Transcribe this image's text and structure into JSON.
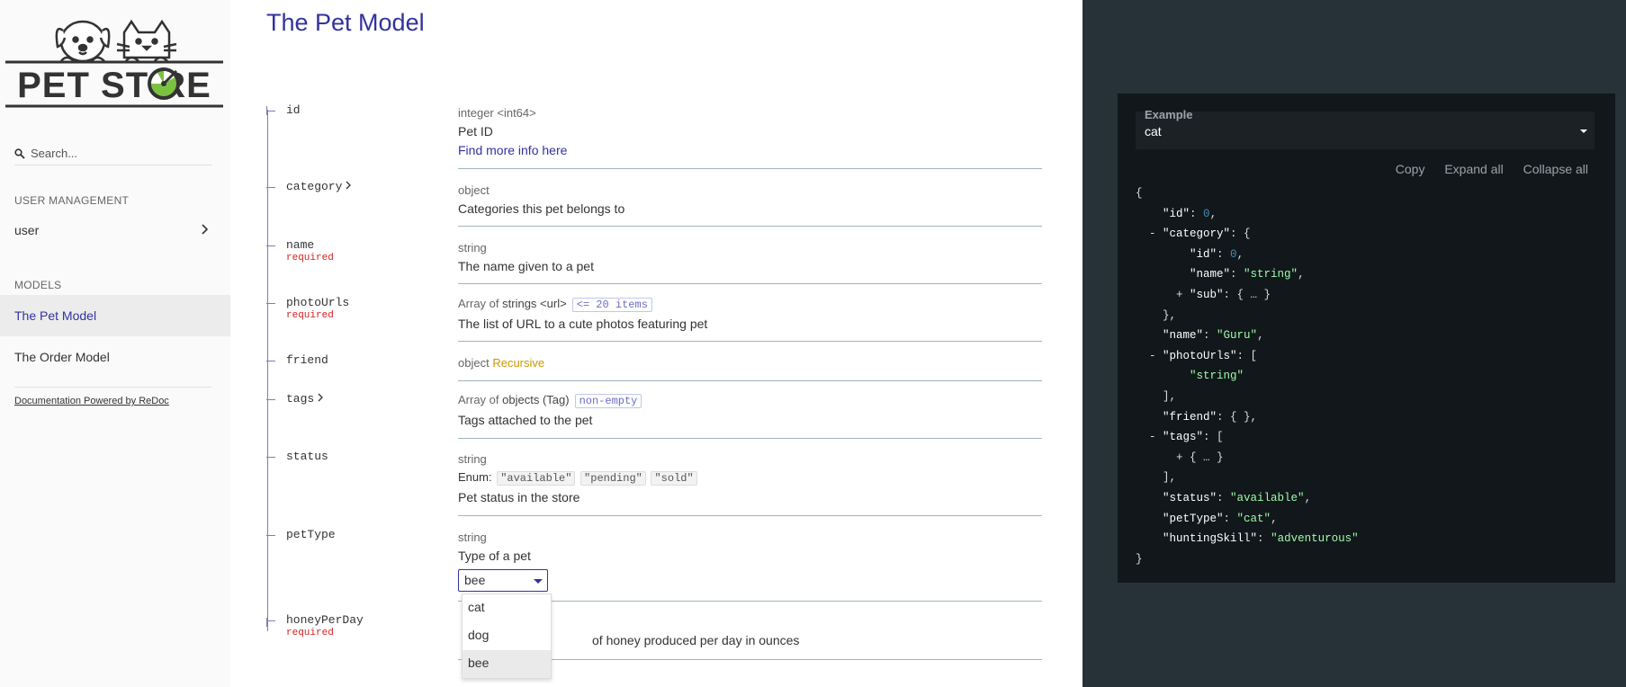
{
  "sidebar": {
    "logo_text": "PET STORE",
    "search_placeholder": "Search...",
    "sections": [
      {
        "label": "USER MANAGEMENT",
        "items": [
          {
            "label": "user"
          }
        ]
      },
      {
        "label": "MODELS",
        "items": [
          {
            "label": "The Pet Model",
            "active": true
          },
          {
            "label": "The Order Model"
          }
        ]
      }
    ],
    "powered_by": "Documentation Powered by ReDoc"
  },
  "main": {
    "title": "The Pet Model",
    "properties": [
      {
        "name": "id",
        "type": "integer <int64>",
        "description": "Pet ID",
        "link": "Find more info here"
      },
      {
        "name": "category",
        "type": "object",
        "description": "Categories this pet belongs to"
      },
      {
        "name": "name",
        "required": "required",
        "type": "string",
        "description": "The name given to a pet"
      },
      {
        "name": "photoUrls",
        "required": "required",
        "type_prefix": "Array of",
        "type_main": "strings <url>",
        "constraint": "<= 20 items",
        "description": "The list of URL to a cute photos featuring pet"
      },
      {
        "name": "friend",
        "type": "object",
        "recursive": "Recursive"
      },
      {
        "name": "tags",
        "type_prefix": "Array of",
        "type_main": "objects (Tag)",
        "constraint": "non-empty",
        "description": "Tags attached to the pet"
      },
      {
        "name": "status",
        "type": "string",
        "enum_label": "Enum:",
        "enum_values": [
          "\"available\"",
          "\"pending\"",
          "\"sold\""
        ],
        "description": "Pet status in the store"
      },
      {
        "name": "petType",
        "type": "string",
        "description": "Type of a pet",
        "select_value": "bee"
      },
      {
        "name": "honeyPerDay",
        "required": "required",
        "description_visible": "of honey produced per day in ounces"
      }
    ],
    "dropdown_options": [
      "cat",
      "dog",
      "bee"
    ]
  },
  "right_panel": {
    "example_label": "Example",
    "example_value": "cat",
    "buttons": [
      "Copy",
      "Expand all",
      "Collapse all"
    ]
  }
}
